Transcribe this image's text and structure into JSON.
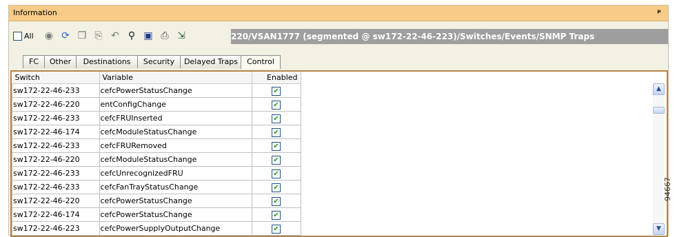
{
  "window": {
    "title": "Information",
    "pin_glyph": "ᵖ"
  },
  "toolbar": {
    "all_label": "All",
    "path": "220/VSAN1777 (segmented @ sw172-22-46-223)/Switches/Events/SNMP Traps",
    "icons": [
      "refresh-icon",
      "apply-icon",
      "copy-icon",
      "paste-icon",
      "undo-icon",
      "find-icon",
      "save-icon",
      "print-icon",
      "export-icon"
    ]
  },
  "tabs": [
    "FC",
    "Other",
    "Destinations",
    "Security",
    "Delayed Traps",
    "Control"
  ],
  "active_tab": "Control",
  "table": {
    "columns": [
      "Switch",
      "Variable",
      "Enabled"
    ],
    "rows": [
      {
        "switch": "sw172-22-46-233",
        "variable": "cefcPowerStatusChange"
      },
      {
        "switch": "sw172-22-46-220",
        "variable": "entConfigChange"
      },
      {
        "switch": "sw172-22-46-233",
        "variable": "cefcFRUInserted"
      },
      {
        "switch": "sw172-22-46-174",
        "variable": "cefcModuleStatusChange"
      },
      {
        "switch": "sw172-22-46-233",
        "variable": "cefcFRURemoved"
      },
      {
        "switch": "sw172-22-46-220",
        "variable": "cefcModuleStatusChange"
      },
      {
        "switch": "sw172-22-46-233",
        "variable": "cefcUnrecognizedFRU"
      },
      {
        "switch": "sw172-22-46-233",
        "variable": "cefcFanTrayStatusChange"
      },
      {
        "switch": "sw172-22-46-220",
        "variable": "cefcPowerStatusChange"
      },
      {
        "switch": "sw172-22-46-174",
        "variable": "cefcPowerStatusChange"
      },
      {
        "switch": "sw172-22-46-223",
        "variable": "cefcPowerSupplyOutputChange"
      }
    ],
    "enabled_mark": "✔"
  },
  "figure_id": "94667",
  "colors": {
    "title_bar": "#f7cc88",
    "path_bar": "#9e9e9e",
    "content_border": "#b5854b"
  }
}
